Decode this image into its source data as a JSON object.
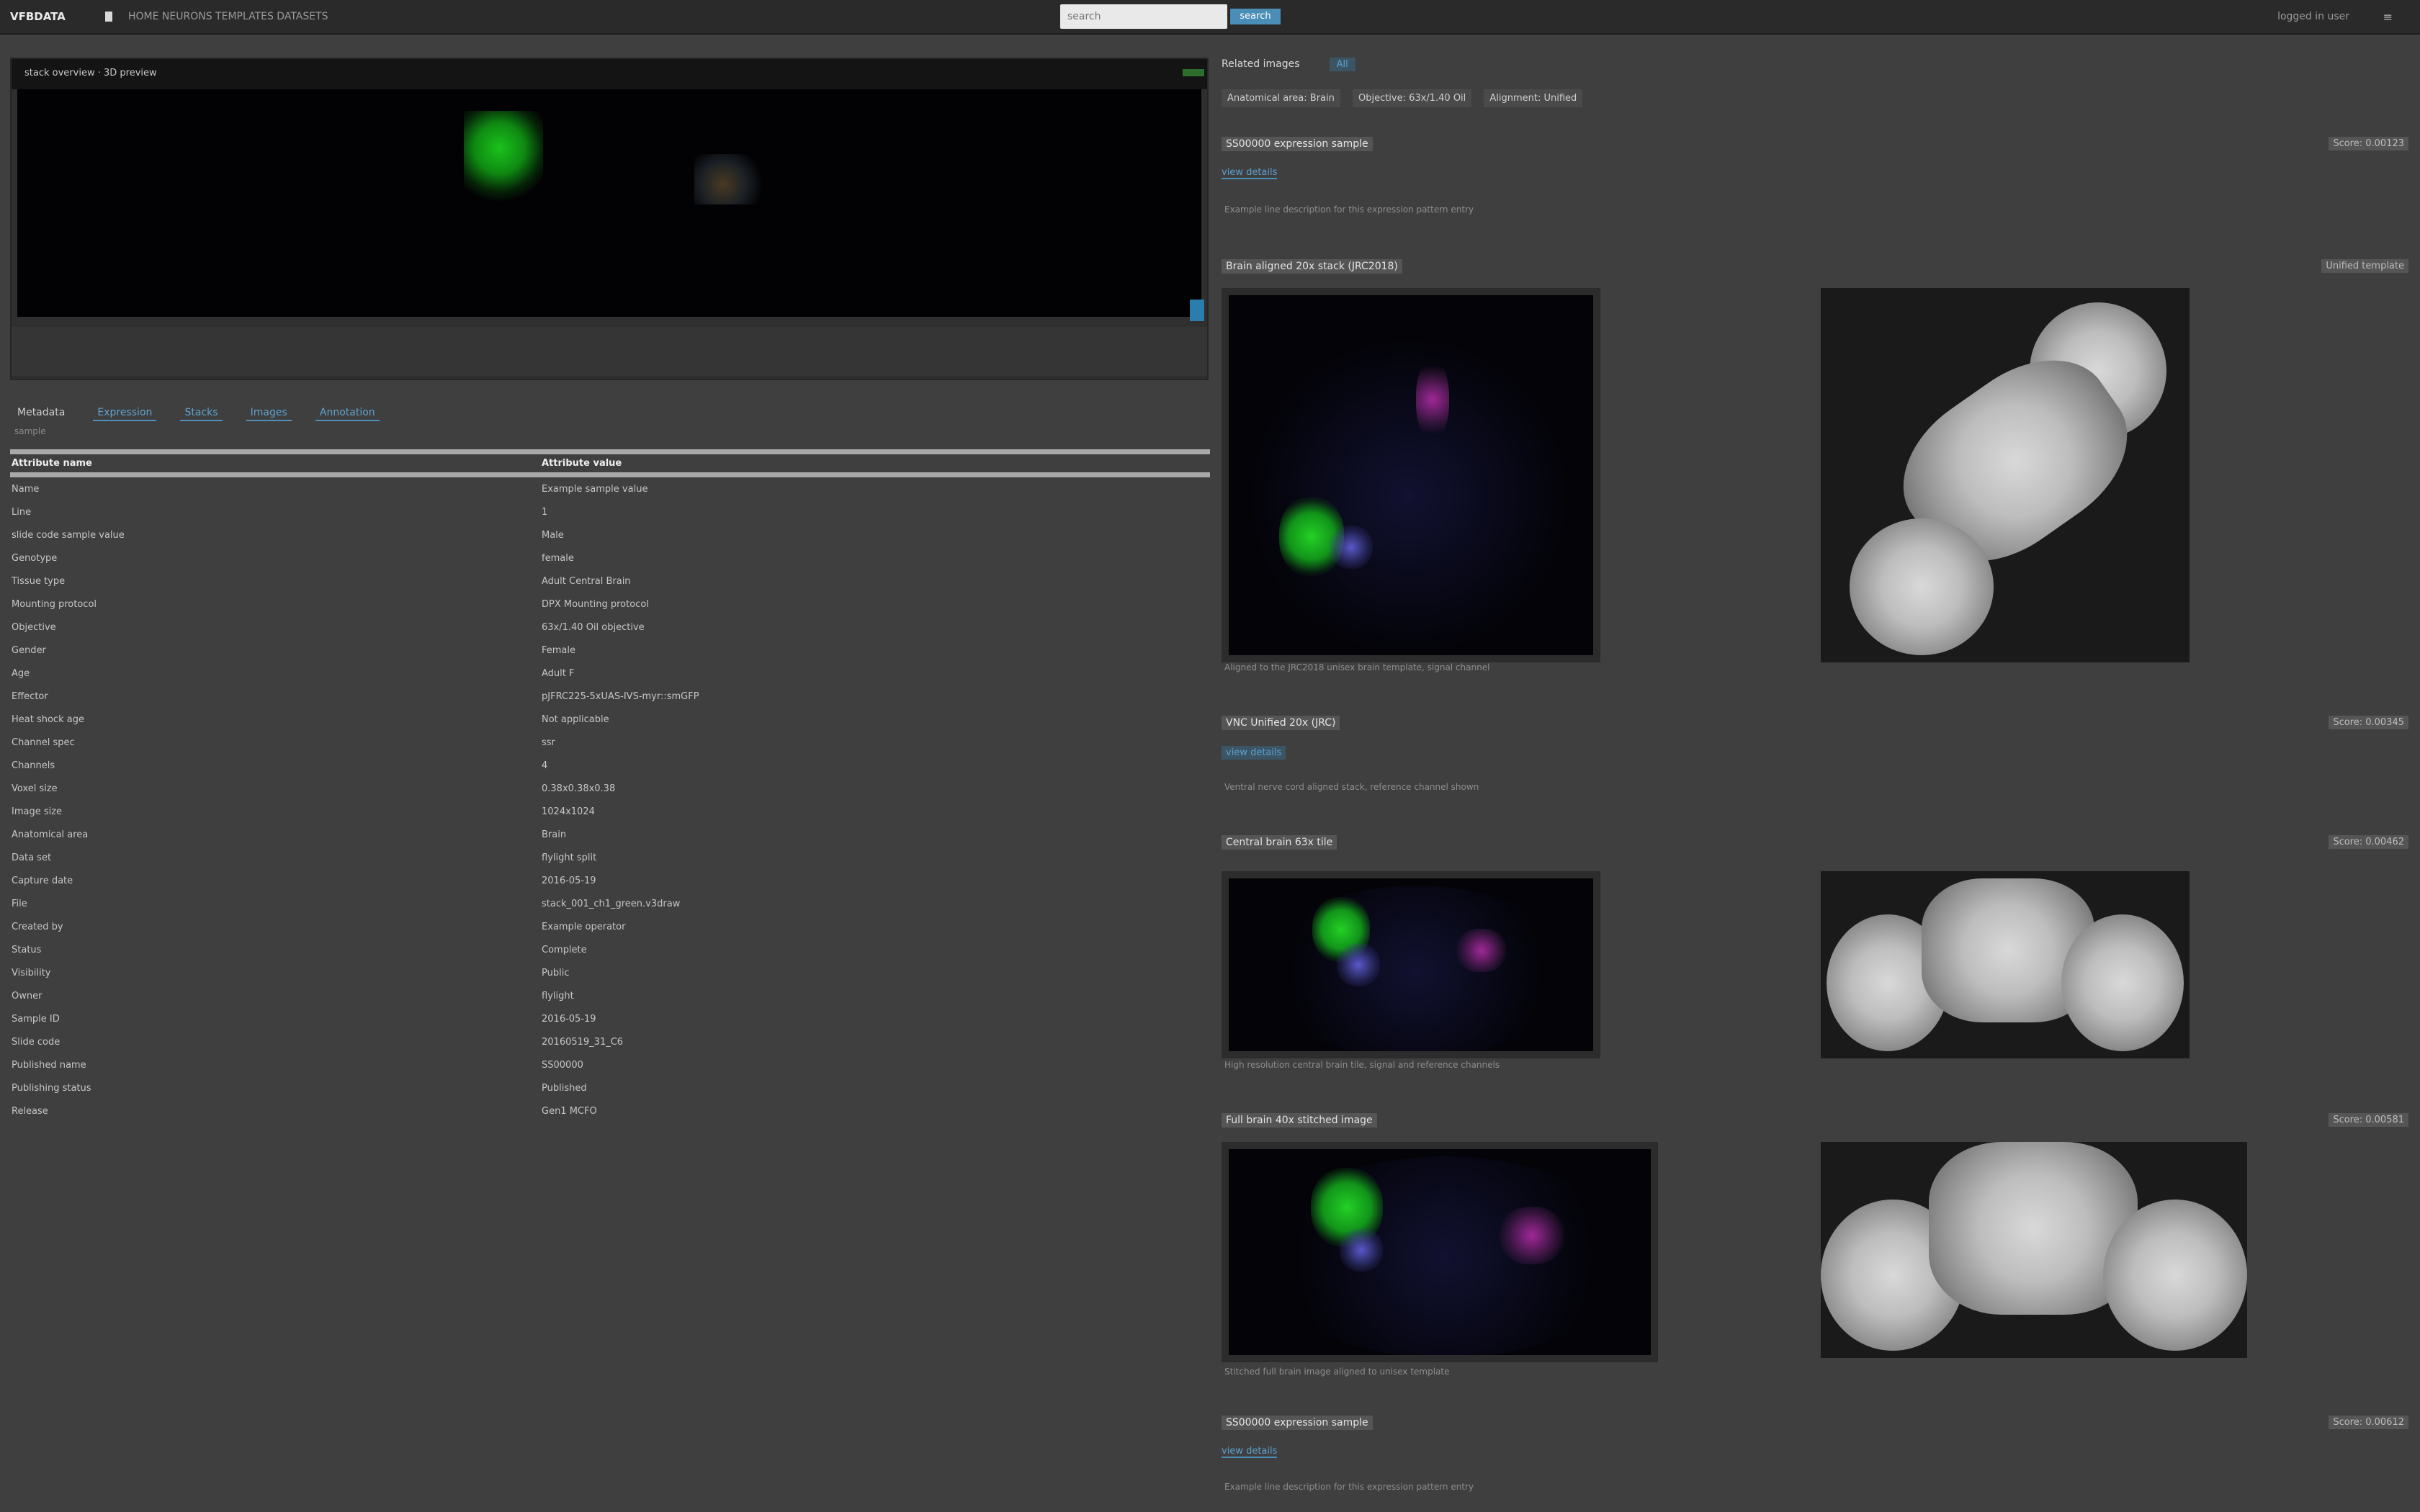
{
  "topbar": {
    "brand": "VFBDATA",
    "crumbs": "HOME   NEURONS   TEMPLATES   DATASETS",
    "search_placeholder": "search",
    "search_button": "search",
    "user": "logged in user",
    "menu": "≡"
  },
  "viewer": {
    "title": "stack overview  ·  3D preview",
    "tabs": [
      {
        "label": "Metadata"
      },
      {
        "label": "Expression"
      },
      {
        "label": "Stacks"
      },
      {
        "label": "Images"
      },
      {
        "label": "Annotation"
      }
    ],
    "tabs_sub": "sample"
  },
  "metadata": {
    "header_key": "Attribute name",
    "header_value": "Attribute value",
    "rows": [
      {
        "k": "Name",
        "v": "Example sample value"
      },
      {
        "k": "Line",
        "v": "1"
      },
      {
        "k": "slide code sample value",
        "v": "Male"
      },
      {
        "k": "Genotype",
        "v": "female"
      },
      {
        "k": "Tissue type",
        "v": "Adult Central Brain"
      },
      {
        "k": "Mounting protocol",
        "v": "DPX Mounting protocol"
      },
      {
        "k": "Objective",
        "v": "63x/1.40 Oil objective"
      },
      {
        "k": "Gender",
        "v": "Female"
      },
      {
        "k": "Age",
        "v": "Adult F"
      },
      {
        "k": "Effector",
        "v": "pJFRC225-5xUAS-IVS-myr::smGFP"
      },
      {
        "k": "Heat shock age",
        "v": "Not applicable"
      },
      {
        "k": "Channel spec",
        "v": "ssr"
      },
      {
        "k": "Channels",
        "v": "4"
      },
      {
        "k": "Voxel size",
        "v": "0.38x0.38x0.38"
      },
      {
        "k": "Image size",
        "v": "1024x1024"
      },
      {
        "k": "Anatomical area",
        "v": "Brain"
      },
      {
        "k": "Data set",
        "v": "flylight split"
      },
      {
        "k": "Capture date",
        "v": "2016-05-19"
      },
      {
        "k": "File",
        "v": "stack_001_ch1_green.v3draw"
      },
      {
        "k": "Created by",
        "v": "Example operator"
      },
      {
        "k": "Status",
        "v": "Complete"
      },
      {
        "k": "Visibility",
        "v": "Public"
      },
      {
        "k": "Owner",
        "v": "flylight"
      },
      {
        "k": "Sample ID",
        "v": "2016-05-19"
      },
      {
        "k": "Slide code",
        "v": "20160519_31_C6"
      },
      {
        "k": "Published name",
        "v": "SS00000"
      },
      {
        "k": "Publishing status",
        "v": "Published"
      },
      {
        "k": "Release",
        "v": "Gen1 MCFO"
      }
    ]
  },
  "results": {
    "tab_title": "Related images",
    "tab_badge": "All",
    "filters": [
      "Anatomical area: Brain",
      "Objective: 63x/1.40 Oil",
      "Alignment: Unified"
    ],
    "items": [
      {
        "name": "SS00000 expression sample",
        "score": "Score: 0.00123",
        "link": "view details",
        "desc": "Example line description for this expression pattern entry"
      },
      {
        "name": "Brain aligned 20x stack (JRC2018)",
        "score": "Unified template",
        "desc": "Aligned to the JRC2018 unisex brain template, signal channel"
      },
      {
        "name": "VNC Unified 20x (JRC)",
        "score": "Score: 0.00345",
        "link": "view details",
        "desc": "Ventral nerve cord aligned stack, reference channel shown"
      },
      {
        "name": "Central brain 63x tile",
        "score": "Score: 0.00462",
        "desc": "High resolution central brain tile, signal and reference channels"
      },
      {
        "name": "Full brain 40x stitched image",
        "score": "Score: 0.00581",
        "desc": "Stitched full brain image aligned to unisex template"
      },
      {
        "name": "SS00000 expression sample",
        "score": "Score: 0.00612",
        "link": "view details",
        "desc": "Example line description for this expression pattern entry"
      }
    ]
  },
  "colors": {
    "background": "#3f3f3f",
    "topbar": "#2a2a2a",
    "accent": "#4a8db6",
    "signal": "#19c21b"
  }
}
